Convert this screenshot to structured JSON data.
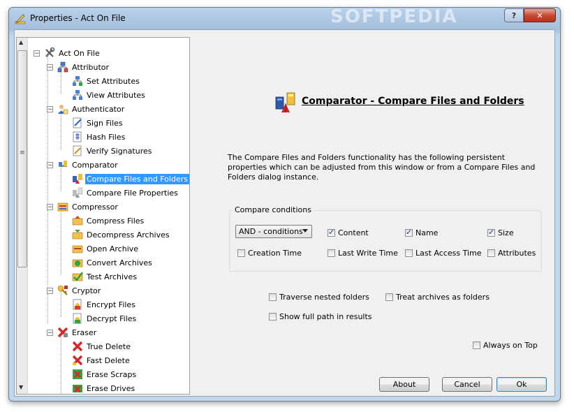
{
  "window": {
    "title": "Properties - Act On File",
    "help_label": "?",
    "close_label": "✕"
  },
  "tree": {
    "root": {
      "label": "Act On File",
      "expander": "−"
    },
    "groups": [
      {
        "label": "Attributor",
        "expander": "−",
        "children": [
          "Set Attributes",
          "View Attributes"
        ]
      },
      {
        "label": "Authenticator",
        "expander": "−",
        "children": [
          "Sign Files",
          "Hash Files",
          "Verify Signatures"
        ]
      },
      {
        "label": "Comparator",
        "expander": "−",
        "children": [
          "Compare Files and Folders",
          "Compare File Properties"
        ]
      },
      {
        "label": "Compressor",
        "expander": "−",
        "children": [
          "Compress Files",
          "Decompress Archives",
          "Open Archive",
          "Convert Archives",
          "Test Archives"
        ]
      },
      {
        "label": "Cryptor",
        "expander": "−",
        "children": [
          "Encrypt Files",
          "Decrypt Files"
        ]
      },
      {
        "label": "Eraser",
        "expander": "−",
        "children": [
          "True Delete",
          "Fast Delete",
          "Erase Scraps",
          "Erase Drives"
        ]
      }
    ],
    "selected": "Compare Files and Folders"
  },
  "panel": {
    "title": "Comparator - Compare Files and Folders",
    "description": "The Compare Files and Folders functionality has the following persistent properties which can be adjusted from this window or from a Compare Files and Folders dialog instance."
  },
  "compare_conditions": {
    "group_label": "Compare conditions",
    "mode_selected": "AND - conditions",
    "content": {
      "label": "Content",
      "checked": true
    },
    "name": {
      "label": "Name",
      "checked": true
    },
    "size": {
      "label": "Size",
      "checked": true
    },
    "creation_time": {
      "label": "Creation Time",
      "checked": false
    },
    "last_write_time": {
      "label": "Last Write Time",
      "checked": false
    },
    "last_access_time": {
      "label": "Last Access Time",
      "checked": false
    },
    "attributes": {
      "label": "Attributes",
      "checked": false
    }
  },
  "options": {
    "traverse_nested": {
      "label": "Traverse nested folders",
      "checked": false
    },
    "treat_archives": {
      "label": "Treat archives as folders",
      "checked": false
    },
    "show_full_path": {
      "label": "Show full path in results",
      "checked": false
    },
    "always_on_top": {
      "label": "Always on Top",
      "checked": false
    }
  },
  "buttons": {
    "about": "About",
    "cancel": "Cancel",
    "ok": "Ok"
  },
  "watermark": "SOFTPEDIA",
  "icons": {
    "title": "pencil-icon",
    "root": "tools-icon",
    "attributor": "network-icon",
    "authenticator": "user-certificate-icon",
    "comparator": "compare-icon",
    "compressor": "archive-icon",
    "cryptor": "key-icon",
    "eraser": "delete-x-icon"
  }
}
